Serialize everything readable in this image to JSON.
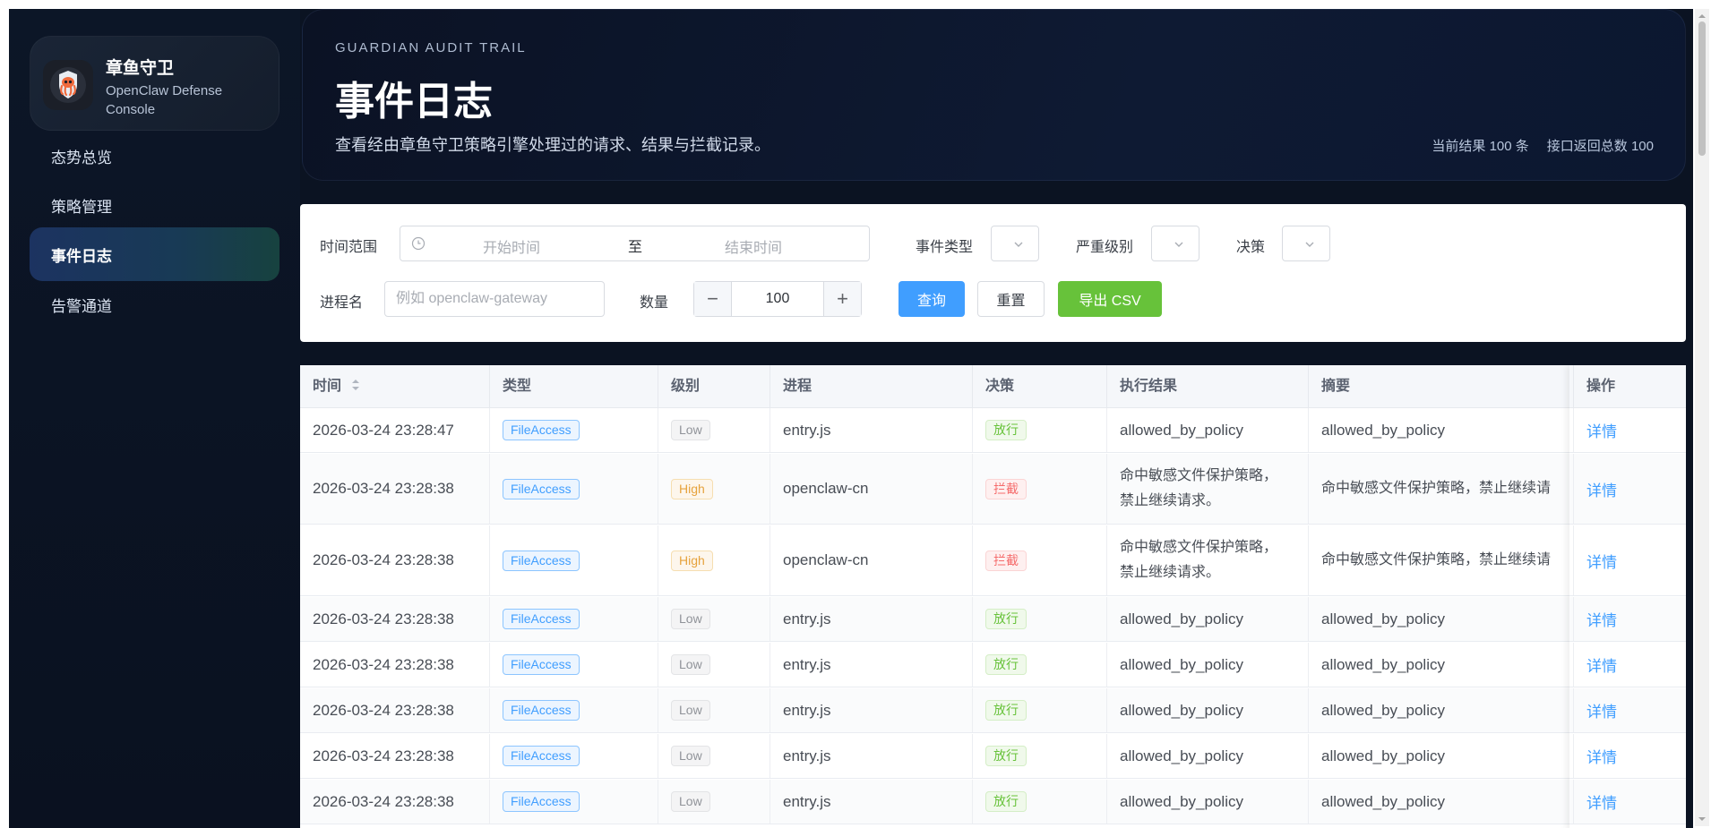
{
  "brand": {
    "title": "章鱼守卫",
    "subtitle": "OpenClaw Defense Console"
  },
  "nav": {
    "items": [
      {
        "label": "态势总览",
        "active": false
      },
      {
        "label": "策略管理",
        "active": false
      },
      {
        "label": "事件日志",
        "active": true
      },
      {
        "label": "告警通道",
        "active": false
      }
    ]
  },
  "hero": {
    "kicker": "GUARDIAN AUDIT TRAIL",
    "title": "事件日志",
    "description": "查看经由章鱼守卫策略引擎处理过的请求、结果与拦截记录。",
    "stat_current": "当前结果 100 条",
    "stat_total": "接口返回总数 100"
  },
  "filters": {
    "time_range_label": "时间范围",
    "start_placeholder": "开始时间",
    "range_separator": "至",
    "end_placeholder": "结束时间",
    "event_type_label": "事件类型",
    "severity_label": "严重级别",
    "decision_label": "决策",
    "process_label": "进程名",
    "process_placeholder": "例如 openclaw-gateway",
    "count_label": "数量",
    "count_value": "100",
    "query_button": "查询",
    "reset_button": "重置",
    "export_button": "导出 CSV"
  },
  "table": {
    "columns": {
      "time": "时间",
      "type": "类型",
      "level": "级别",
      "process": "进程",
      "decision": "决策",
      "result": "执行结果",
      "summary": "摘要",
      "action": "操作"
    },
    "rows": [
      {
        "time": "2026-03-24 23:28:47",
        "type": "FileAccess",
        "level": "Low",
        "process": "entry.js",
        "decision": "放行",
        "result1": "allowed_by_policy",
        "result2": "",
        "summary": "allowed_by_policy",
        "action": "详情"
      },
      {
        "time": "2026-03-24 23:28:38",
        "type": "FileAccess",
        "level": "High",
        "process": "openclaw-cn",
        "decision": "拦截",
        "result1": "命中敏感文件保护策略，",
        "result2": "禁止继续请求。",
        "summary": "命中敏感文件保护策略，禁止继续请",
        "action": "详情"
      },
      {
        "time": "2026-03-24 23:28:38",
        "type": "FileAccess",
        "level": "High",
        "process": "openclaw-cn",
        "decision": "拦截",
        "result1": "命中敏感文件保护策略，",
        "result2": "禁止继续请求。",
        "summary": "命中敏感文件保护策略，禁止继续请",
        "action": "详情"
      },
      {
        "time": "2026-03-24 23:28:38",
        "type": "FileAccess",
        "level": "Low",
        "process": "entry.js",
        "decision": "放行",
        "result1": "allowed_by_policy",
        "result2": "",
        "summary": "allowed_by_policy",
        "action": "详情"
      },
      {
        "time": "2026-03-24 23:28:38",
        "type": "FileAccess",
        "level": "Low",
        "process": "entry.js",
        "decision": "放行",
        "result1": "allowed_by_policy",
        "result2": "",
        "summary": "allowed_by_policy",
        "action": "详情"
      },
      {
        "time": "2026-03-24 23:28:38",
        "type": "FileAccess",
        "level": "Low",
        "process": "entry.js",
        "decision": "放行",
        "result1": "allowed_by_policy",
        "result2": "",
        "summary": "allowed_by_policy",
        "action": "详情"
      },
      {
        "time": "2026-03-24 23:28:38",
        "type": "FileAccess",
        "level": "Low",
        "process": "entry.js",
        "decision": "放行",
        "result1": "allowed_by_policy",
        "result2": "",
        "summary": "allowed_by_policy",
        "action": "详情"
      },
      {
        "time": "2026-03-24 23:28:38",
        "type": "FileAccess",
        "level": "Low",
        "process": "entry.js",
        "decision": "放行",
        "result1": "allowed_by_policy",
        "result2": "",
        "summary": "allowed_by_policy",
        "action": "详情"
      }
    ]
  },
  "colors": {
    "primary": "#409eff",
    "success": "#67c23a",
    "danger": "#f56c6c",
    "warning": "#e6a23c",
    "sidebar_bg": "#0c1627"
  }
}
